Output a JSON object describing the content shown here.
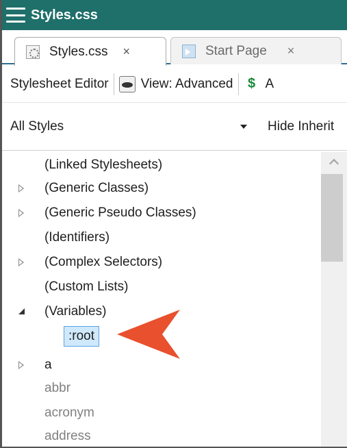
{
  "window": {
    "title": "Styles.css"
  },
  "tabs": [
    {
      "label": "Styles.css",
      "close": "×",
      "active": true
    },
    {
      "label": "Start Page",
      "close": "×",
      "active": false
    }
  ],
  "toolbar": {
    "editor_label": "Stylesheet Editor",
    "view_label": "View: Advanced",
    "add_label": "A"
  },
  "filter": {
    "selected": "All Styles",
    "hide_inherited": "Hide Inherit"
  },
  "tree": {
    "items": [
      {
        "label": "(Linked Stylesheets)",
        "expander": "none"
      },
      {
        "label": "(Generic Classes)",
        "expander": "collapsed"
      },
      {
        "label": "(Generic Pseudo Classes)",
        "expander": "collapsed"
      },
      {
        "label": "(Identifiers)",
        "expander": "none"
      },
      {
        "label": "(Complex Selectors)",
        "expander": "collapsed"
      },
      {
        "label": "(Custom Lists)",
        "expander": "none"
      },
      {
        "label": "(Variables)",
        "expander": "expanded"
      },
      {
        "label": ":root",
        "child": true,
        "selected": true
      },
      {
        "label": "a",
        "expander": "collapsed"
      },
      {
        "label": "abbr",
        "muted": true
      },
      {
        "label": "acronym",
        "muted": true
      },
      {
        "label": "address",
        "muted": true
      }
    ]
  },
  "colors": {
    "title_bar": "#1f6f6a",
    "selection": "#cfe8fb",
    "callout_arrow": "#e8502e",
    "muted_text": "#808080"
  },
  "icons": {
    "menu": "hamburger-icon",
    "css_file": "css-file-icon",
    "start_page": "start-page-icon",
    "view": "eye-icon",
    "add": "add-style-icon",
    "callout": "callout-arrow-icon"
  }
}
